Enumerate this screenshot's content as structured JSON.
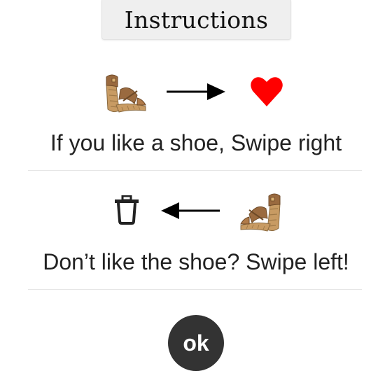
{
  "header": {
    "title": "Instructions"
  },
  "instruction_like": {
    "left_icon": "wedge-sandal-icon",
    "arrow": "arrow-right-icon",
    "right_icon": "heart-icon",
    "text": "If you like a shoe, Swipe right"
  },
  "instruction_dislike": {
    "left_icon": "trash-icon",
    "arrow": "arrow-left-icon",
    "right_icon": "wedge-sandal-icon",
    "text": "Don’t like the shoe? Swipe left!"
  },
  "ok_button": {
    "label": "ok"
  },
  "colors": {
    "heart": "#ff0000",
    "button_bg": "#333333",
    "title_tab_bg": "#efefef",
    "text": "#222222",
    "shoe_leather": "#9a6a3f",
    "shoe_wedge": "#c89b63"
  }
}
